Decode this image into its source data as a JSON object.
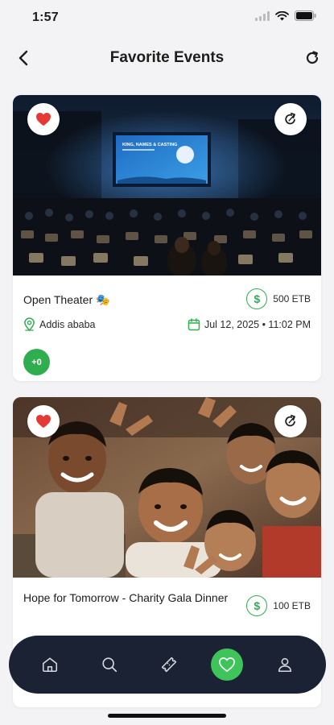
{
  "status_bar": {
    "time": "1:57"
  },
  "header": {
    "title": "Favorite Events"
  },
  "events": [
    {
      "title": "Open Theater 🎭",
      "price": "500 ETB",
      "location": "Addis ababa",
      "datetime": "Jul 12, 2025 • 11:02 PM",
      "attendees": "+0",
      "screen_text": "KING, NAMES & CASTING"
    },
    {
      "title": "Hope for Tomorrow - Charity Gala Dinner",
      "price": "100 ETB"
    }
  ],
  "nav": {
    "items": [
      "home-icon",
      "search-icon",
      "ticket-icon",
      "heart-icon",
      "profile-icon"
    ],
    "active": "heart-icon"
  },
  "colors": {
    "accent": "#2fae4f",
    "nav_bg": "#1a2233",
    "nav_active": "#3ec45b",
    "favorite_red": "#e53935"
  }
}
